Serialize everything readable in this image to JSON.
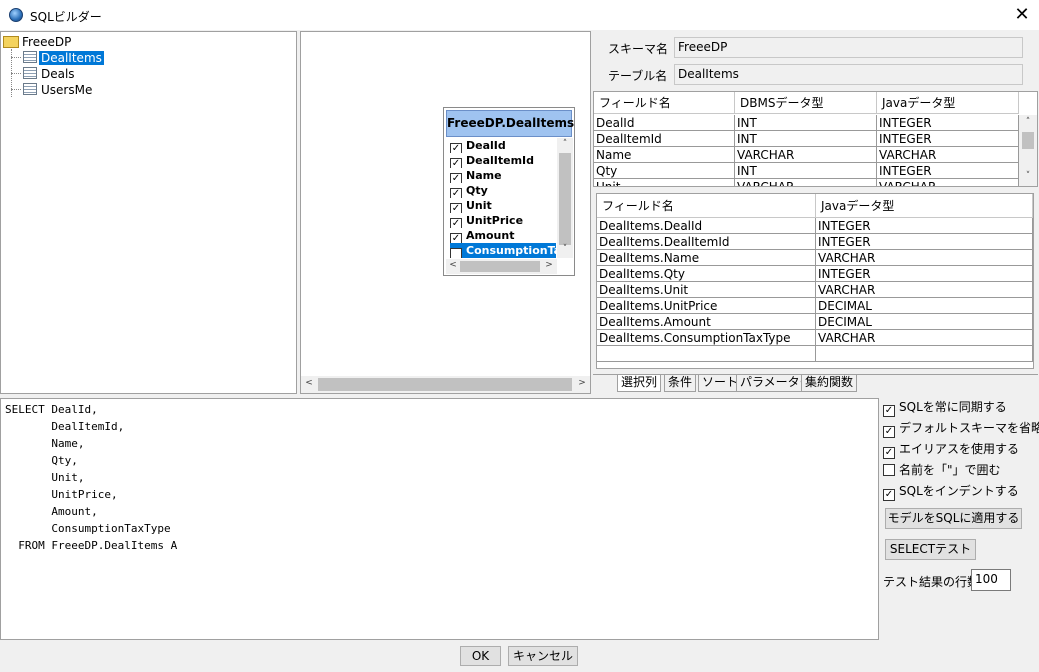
{
  "window": {
    "title": "SQLビルダー",
    "close_symbol": "✕"
  },
  "tree": {
    "root": "FreeeDP",
    "items": [
      "DealItems",
      "Deals",
      "UsersMe"
    ],
    "selected": "DealItems"
  },
  "entity": {
    "title": "FreeeDP.DealItems",
    "fields": [
      "DealId",
      "DealItemId",
      "Name",
      "Qty",
      "Unit",
      "UnitPrice",
      "Amount",
      "ConsumptionTax"
    ],
    "selected_index": 7
  },
  "schema": {
    "schema_label": "スキーマ名",
    "schema_value": "FreeeDP",
    "table_label": "テーブル名",
    "table_value": "DealItems"
  },
  "fields_grid": {
    "headers": [
      "フィールド名",
      "DBMSデータ型",
      "Javaデータ型"
    ],
    "rows": [
      [
        "DealId",
        "INT",
        "INTEGER"
      ],
      [
        "DealItemId",
        "INT",
        "INTEGER"
      ],
      [
        "Name",
        "VARCHAR",
        "VARCHAR"
      ],
      [
        "Qty",
        "INT",
        "INTEGER"
      ],
      [
        "Unit",
        "VARCHAR",
        "VARCHAR"
      ]
    ]
  },
  "selected_grid": {
    "headers": [
      "フィールド名",
      "Javaデータ型"
    ],
    "rows": [
      [
        "DealItems.DealId",
        "INTEGER"
      ],
      [
        "DealItems.DealItemId",
        "INTEGER"
      ],
      [
        "DealItems.Name",
        "VARCHAR"
      ],
      [
        "DealItems.Qty",
        "INTEGER"
      ],
      [
        "DealItems.Unit",
        "VARCHAR"
      ],
      [
        "DealItems.UnitPrice",
        "DECIMAL"
      ],
      [
        "DealItems.Amount",
        "DECIMAL"
      ],
      [
        "DealItems.ConsumptionTaxType",
        "VARCHAR"
      ],
      [
        "",
        ""
      ]
    ]
  },
  "tabs": [
    "選択列",
    "条件",
    "ソート",
    "パラメーター",
    "集約関数"
  ],
  "sql_lines": [
    "SELECT DealId,",
    "       DealItemId,",
    "       Name,",
    "       Qty,",
    "       Unit,",
    "       UnitPrice,",
    "       Amount,",
    "       ConsumptionTaxType",
    "  FROM FreeeDP.DealItems A"
  ],
  "options": [
    {
      "label": "SQLを常に同期する",
      "checked": true
    },
    {
      "label": "デフォルトスキーマを省略する",
      "checked": true
    },
    {
      "label": "エイリアスを使用する",
      "checked": true
    },
    {
      "label": "名前を「\"」で囲む",
      "checked": false
    },
    {
      "label": "SQLをインデントする",
      "checked": true
    }
  ],
  "buttons": {
    "apply_model": "モデルをSQLに適用する",
    "select_test": "SELECTテスト",
    "ok": "OK",
    "cancel": "キャンセル"
  },
  "test_rows": {
    "label": "テスト結果の行数",
    "value": "100"
  }
}
